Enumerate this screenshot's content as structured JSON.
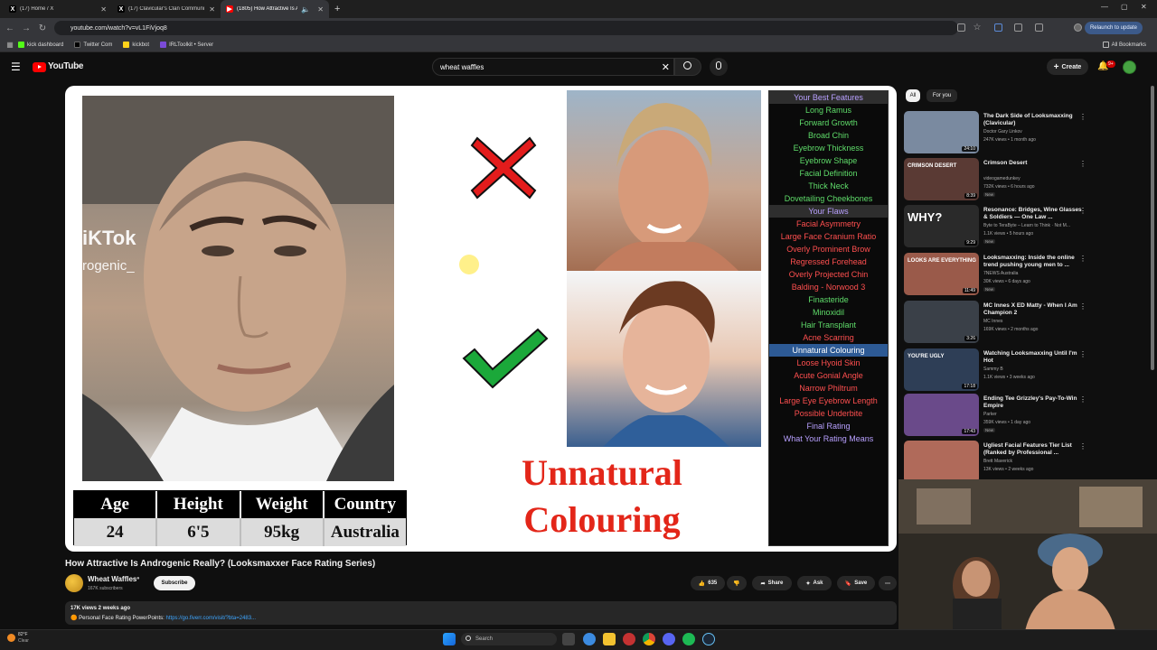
{
  "browser": {
    "tabs": [
      {
        "title": "(17) Home / X",
        "icon": "x-logo"
      },
      {
        "title": "(17) Clavicular's Clan Communi",
        "icon": "x-logo"
      },
      {
        "title": "(1805) How Attractive Is An",
        "icon": "youtube-logo"
      }
    ],
    "url": "youtube.com/watch?v=vL1FiVjoq8",
    "relaunch_label": "Relaunch to update",
    "bookmarks": [
      "kick dashboard",
      "Twitter Com",
      "kickbot",
      "IRLToolkit • Server"
    ],
    "all_bookmarks": "All Bookmarks"
  },
  "youtube": {
    "logo_text": "YouTube",
    "search_query": "wheat waffles",
    "create_label": "Create",
    "notifications_badge": "9+"
  },
  "video": {
    "overlay_tiktok": "iKTok",
    "overlay_user": "rogenic_",
    "stats_headers": [
      "Age",
      "Height",
      "Weight",
      "Country"
    ],
    "stats_values": [
      "24",
      "6'5",
      "95kg",
      "Australia"
    ],
    "caption": [
      "Unnatural",
      "Colouring"
    ],
    "features": [
      {
        "text": "Your Best Features",
        "kind": "sec"
      },
      {
        "text": "Long Ramus",
        "kind": "good"
      },
      {
        "text": "Forward Growth",
        "kind": "good"
      },
      {
        "text": "Broad Chin",
        "kind": "good"
      },
      {
        "text": "Eyebrow Thickness",
        "kind": "good"
      },
      {
        "text": "Eyebrow Shape",
        "kind": "good"
      },
      {
        "text": "Facial Definition",
        "kind": "good"
      },
      {
        "text": "Thick Neck",
        "kind": "good"
      },
      {
        "text": "Dovetailing Cheekbones",
        "kind": "good"
      },
      {
        "text": "Your Flaws",
        "kind": "sec"
      },
      {
        "text": "Facial Asymmetry",
        "kind": "bad"
      },
      {
        "text": "Large Face Cranium Ratio",
        "kind": "bad"
      },
      {
        "text": "Overly Prominent Brow",
        "kind": "bad"
      },
      {
        "text": "Regressed Forehead",
        "kind": "bad"
      },
      {
        "text": "Overly Projected Chin",
        "kind": "bad"
      },
      {
        "text": "Balding - Norwood 3",
        "kind": "bad"
      },
      {
        "text": "Finasteride",
        "kind": "good"
      },
      {
        "text": "Minoxidil",
        "kind": "good"
      },
      {
        "text": "Hair Transplant",
        "kind": "good"
      },
      {
        "text": "Acne Scarring",
        "kind": "bad"
      },
      {
        "text": "Unnatural Colouring",
        "kind": "hl"
      },
      {
        "text": "Loose Hyoid Skin",
        "kind": "bad"
      },
      {
        "text": "Acute Gonial Angle",
        "kind": "bad"
      },
      {
        "text": "Narrow Philtrum",
        "kind": "bad"
      },
      {
        "text": "Large Eye Eyebrow Length",
        "kind": "bad"
      },
      {
        "text": "Possible Underbite",
        "kind": "bad"
      },
      {
        "text": "Final Rating",
        "kind": "fin"
      },
      {
        "text": "What Your Rating Means",
        "kind": "fin"
      }
    ]
  },
  "watch": {
    "title": "How Attractive Is Androgenic Really? (Looksmaxxer Face Rating Series)",
    "channel": "Wheat Waffles",
    "subscribers": "167K subscribers",
    "subscribe_label": "Subscribe",
    "likes": "635",
    "share_label": "Share",
    "ask_label": "Ask",
    "save_label": "Save",
    "meta": "17K views  2 weeks ago",
    "desc_prefix": "🟠 Personal Face Rating PowerPoints:",
    "desc_link": "https://go.fiverr.com/visit/?bta=2483..."
  },
  "sidebar": {
    "chips": [
      "All",
      "For you"
    ],
    "recs": [
      {
        "title": "The Dark Side of Looksmaxxing (Clavicular)",
        "channel": "Doctor Gary Linkov",
        "meta": "247K views • 1 month ago",
        "duration": "24:10",
        "thumb": "#7a8aa0",
        "badge": ""
      },
      {
        "title": "Crimson Desert",
        "channel": "videogamedunkey",
        "meta": "732K views • 6 hours ago",
        "duration": "8:39",
        "thumb": "#5a3a34",
        "badge": "New"
      },
      {
        "title": "Resonance: Bridges, Wine Glasses & Soldiers — One Law ...",
        "channel": "Byte to TeraByte – Learn to Think · Not M...",
        "meta": "1.1K views • 5 hours ago",
        "duration": "9:29",
        "thumb": "#2a2a2a",
        "badge": "New"
      },
      {
        "title": "Looksmaxxing: Inside the online trend pushing young men to ...",
        "channel": "7NEWS Australia",
        "meta": "30K views • 6 days ago",
        "duration": "11:49",
        "thumb": "#9a5a4a",
        "badge": "New"
      },
      {
        "title": "MC Innes X ED Matty - When I Am Champion 2",
        "channel": "MC Innes",
        "meta": "169K views • 2 months ago",
        "duration": "3:26",
        "thumb": "#3a4048",
        "badge": ""
      },
      {
        "title": "Watching Looksmaxxing Until I'm Hot",
        "channel": "Sammy B",
        "meta": "1.1K views • 3 weeks ago",
        "duration": "17:18",
        "thumb": "#2e3e56",
        "badge": ""
      },
      {
        "title": "Ending Tee Grizzley's Pay-To-Win Empire",
        "channel": "Parker",
        "meta": "359K views • 1 day ago",
        "duration": "17:43",
        "thumb": "#6a4a8a",
        "badge": "New"
      },
      {
        "title": "Ugliest Facial Features Tier List (Ranked by Professional ...",
        "channel": "Brett Maverick",
        "meta": "13K views • 2 weeks ago",
        "duration": "",
        "thumb": "#b06a5a",
        "badge": ""
      }
    ],
    "thumb_texts": [
      "",
      "CRIMSON DESERT",
      "WHY?",
      "LOOKS ARE EVERYTHING",
      "",
      "YOU'RE UGLY",
      "",
      ""
    ]
  },
  "taskbar": {
    "temperature": "82°F",
    "condition": "Clear",
    "search_placeholder": "Search"
  }
}
